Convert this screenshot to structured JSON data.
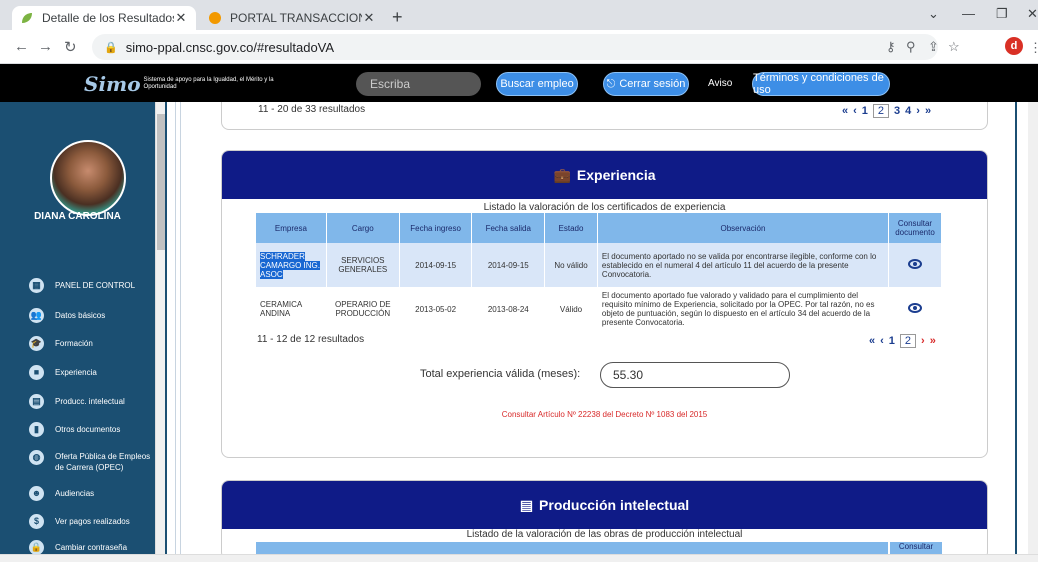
{
  "browser": {
    "tabs": [
      {
        "title": "Detalle de los Resultados de la p",
        "active": true
      },
      {
        "title": "PORTAL TRANSACCIONAL POSIT",
        "active": false
      }
    ],
    "url": "simo-ppal.cnsc.gov.co/#resultadoVA",
    "profile_initial": "d"
  },
  "header": {
    "logo_mark": "Simo",
    "logo_text": "Sistema de apoyo para la Igualdad, el Mérito y la Oportunidad",
    "search_placeholder": "Escriba",
    "buscar_label": "Buscar empleo",
    "cerrar_label": "Cerrar sesión",
    "aviso_label": "Aviso",
    "terminos_label": "Términos y condiciones de uso"
  },
  "sidebar": {
    "user_name": "DIANA CAROLINA",
    "items": [
      {
        "label": "PANEL DE CONTROL",
        "icon": "dashboard-icon",
        "glyph": "▦"
      },
      {
        "label": "Datos básicos",
        "icon": "users-icon",
        "glyph": "👥"
      },
      {
        "label": "Formación",
        "icon": "graduation-icon",
        "glyph": "🎓"
      },
      {
        "label": "Experiencia",
        "icon": "briefcase-icon",
        "glyph": "■"
      },
      {
        "label": "Producc. intelectual",
        "icon": "book-icon",
        "glyph": "▤"
      },
      {
        "label": "Otros documentos",
        "icon": "file-icon",
        "glyph": "▮"
      },
      {
        "label": "Oferta Pública de Empleos de Carrera (OPEC)",
        "icon": "globe-icon",
        "glyph": "◍"
      },
      {
        "label": "Audiencias",
        "icon": "group-icon",
        "glyph": "☻"
      },
      {
        "label": "Ver pagos realizados",
        "icon": "dollar-icon",
        "glyph": "$"
      },
      {
        "label": "Cambiar contraseña",
        "icon": "lock-icon",
        "glyph": "🔒"
      }
    ]
  },
  "prev_section": {
    "results": "11 - 20 de 33 resultados",
    "pages": [
      "1",
      "2",
      "3",
      "4"
    ],
    "current_page": "2"
  },
  "experiencia": {
    "title": "Experiencia",
    "caption": "Listado la valoración de los certificados de experiencia",
    "columns": [
      "Empresa",
      "Cargo",
      "Fecha ingreso",
      "Fecha salida",
      "Estado",
      "Observación",
      "Consultar documento"
    ],
    "rows": [
      {
        "empresa": "SCHRADER CAMARGO ING. ASOC",
        "cargo": "SERVICIOS GENERALES",
        "ingreso": "2014-09-15",
        "salida": "2014-09-15",
        "estado": "No válido",
        "observacion": "El documento aportado no se valida por encontrarse ilegible, conforme con lo establecido en el numeral 4 del artículo 11 del acuerdo de la presente Convocatoria."
      },
      {
        "empresa": "CERAMICA ANDINA",
        "cargo": "OPERARIO DE PRODUCCIÓN",
        "ingreso": "2013-05-02",
        "salida": "2013-08-24",
        "estado": "Válido",
        "observacion": "El documento aportado fue valorado y validado para el cumplimiento del requisito mínimo de Experiencia, solicitado por la OPEC. Por tal razón, no es objeto de puntuación, según lo dispuesto en el artículo 34 del acuerdo de la presente Convocatoria."
      }
    ],
    "results": "11 - 12 de 12 resultados",
    "pages": [
      "1",
      "2"
    ],
    "current_page": "2",
    "total_label": "Total experiencia válida (meses):",
    "total_value": "55.30",
    "decreto_link": "Consultar Artículo Nº 22238 del Decreto Nº 1083 del 2015"
  },
  "produccion": {
    "title": "Producción intelectual",
    "caption": "Listado de la valoración de las obras de producción intelectual",
    "consultar_label": "Consultar"
  }
}
